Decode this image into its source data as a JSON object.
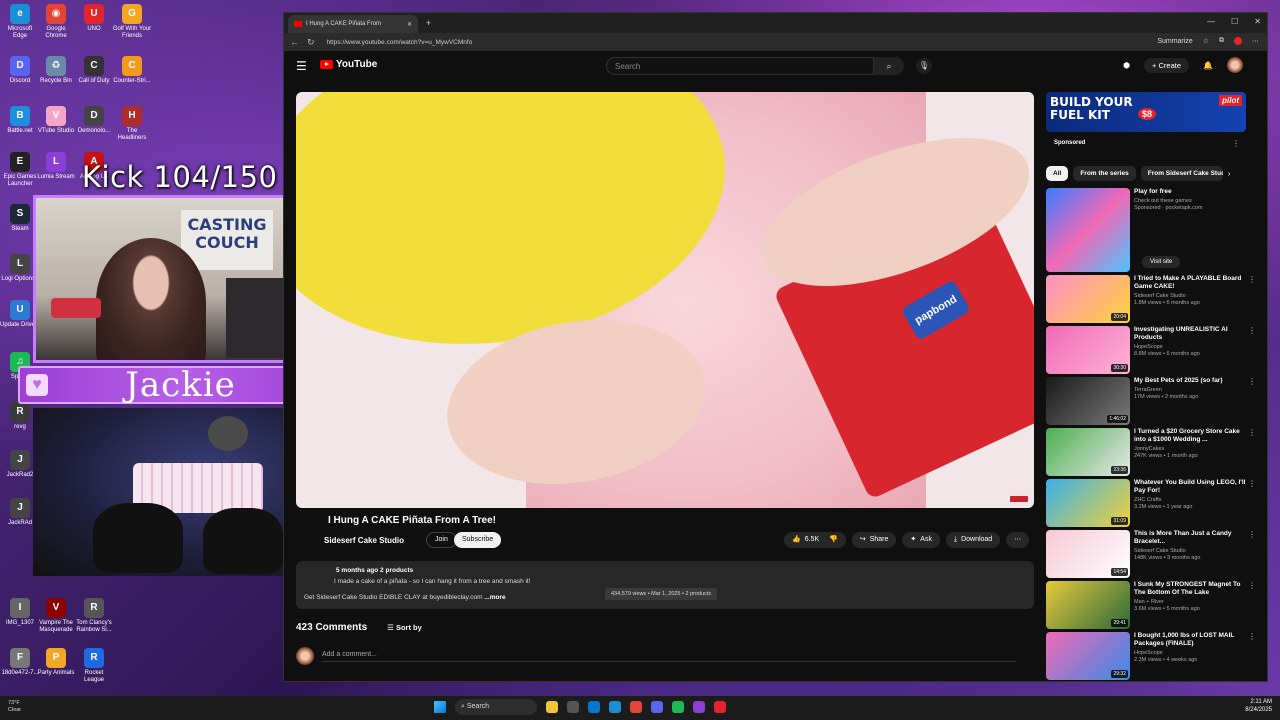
{
  "desktop": {
    "icons": [
      {
        "label": "Microsoft Edge",
        "glyph": "e",
        "color": "#1b8fd6"
      },
      {
        "label": "Google Chrome",
        "glyph": "◉",
        "color": "#e54335"
      },
      {
        "label": "UNO",
        "glyph": "U",
        "color": "#e4232b"
      },
      {
        "label": "Golf With Your Friends",
        "glyph": "G",
        "color": "#f2a623"
      },
      {
        "label": "Discord",
        "glyph": "D",
        "color": "#5865f2"
      },
      {
        "label": "Recycle Bin",
        "glyph": "♻",
        "color": "#6a8aa8"
      },
      {
        "label": "Call of Duty",
        "glyph": "C",
        "color": "#333333"
      },
      {
        "label": "Counter-Stri...",
        "glyph": "C",
        "color": "#f29a1f"
      },
      {
        "label": "Battle.net",
        "glyph": "B",
        "color": "#1d8fe1"
      },
      {
        "label": "VTube Studio",
        "glyph": "V",
        "color": "#f5a5c8"
      },
      {
        "label": "Demonolo...",
        "glyph": "D",
        "color": "#444444"
      },
      {
        "label": "The Headliners",
        "glyph": "H",
        "color": "#b02b2b"
      },
      {
        "label": "Epic Games Launcher",
        "glyph": "E",
        "color": "#222222"
      },
      {
        "label": "Lumia Stream",
        "glyph": "L",
        "color": "#8a3fd6"
      },
      {
        "label": "Among Us",
        "glyph": "A",
        "color": "#c51111"
      },
      {
        "label": "Steam",
        "glyph": "S",
        "color": "#1b2838"
      },
      {
        "label": "Logi Options+",
        "glyph": "L",
        "color": "#444444"
      },
      {
        "label": "Update Drivers",
        "glyph": "U",
        "color": "#2d7ad6"
      },
      {
        "label": "Spotify",
        "glyph": "♫",
        "color": "#1db954"
      },
      {
        "label": "revg",
        "glyph": "R",
        "color": "#3a3a3a"
      },
      {
        "label": "JackRad2",
        "glyph": "J",
        "color": "#444444"
      },
      {
        "label": "JackRAd",
        "glyph": "J",
        "color": "#444444"
      },
      {
        "label": "IMG_1307",
        "glyph": "I",
        "color": "#666666"
      },
      {
        "label": "Vampire The Masquerade",
        "glyph": "V",
        "color": "#8b0000"
      },
      {
        "label": "Tom Clancy's Rainbow Si...",
        "glyph": "R",
        "color": "#555555"
      },
      {
        "label": "18d0e472-7...",
        "glyph": "F",
        "color": "#777777"
      },
      {
        "label": "Party Animals",
        "glyph": "P",
        "color": "#f2a623"
      },
      {
        "label": "Rocket League",
        "glyph": "R",
        "color": "#1d6ae1"
      }
    ]
  },
  "overlay": {
    "kick_counter": "Kick 104/150",
    "webcam_poster": "CASTING COUCH",
    "streamer_name": "Jackie",
    "heart": "♥"
  },
  "browser": {
    "tab_title": "I Hung A CAKE Piñata From",
    "new_tab": "+",
    "window_controls": [
      "—",
      "☐",
      "✕"
    ],
    "url": "https://www.youtube.com/watch?v=u_MywVCMnfo",
    "summarize": "Summarize",
    "nav_back": "←",
    "nav_reload": "↻"
  },
  "youtube": {
    "logo_text": "YouTube",
    "search_placeholder": "Search",
    "create_label": "+ Create",
    "video": {
      "title": "I Hung A CAKE Piñata From A Tree!",
      "channel": "Sideserf Cake Studio",
      "join": "Join",
      "subscribe": "Subscribe",
      "likes": "6.5K",
      "share": "Share",
      "ask": "Ask",
      "download": "Download",
      "desc_meta": "5 months ago  2 products",
      "desc_line1": "I made a cake of a piñata - so I can hang it from a tree and smash it!",
      "desc_line2": "Get Sideserf Cake Studio EDIBLE CLAY at buyedibleclay.com",
      "more": "...more",
      "tooltip": "434,579 views • Mar 1, 2025 • 2 products",
      "candy_label": "papbond"
    },
    "comments": {
      "count": "423 Comments",
      "sort": "Sort by",
      "placeholder": "Add a comment..."
    },
    "ad": {
      "banner_text": "BUILD YOUR FUEL KIT",
      "price": "$8",
      "brand": "pilot",
      "sponsored": "Sponsored"
    },
    "chips": [
      "All",
      "From the series",
      "From Sideserf Cake Studio"
    ],
    "ad_game": {
      "title": "Play for free",
      "subtitle": "Check out these games",
      "sponsor": "Sponsored · pocketapk.com",
      "visit": "Visit site"
    },
    "recommendations": [
      {
        "title": "I Tried to Make A PLAYABLE Board Game CAKE!",
        "channel": "Sideserf Cake Studio",
        "stats": "1.8M views • 6 months ago",
        "duration": "20:04",
        "c1": "#ff8fc7",
        "c2": "#ffd23a"
      },
      {
        "title": "Investigating UNREALISTIC AI Products",
        "channel": "HopeScope",
        "stats": "8.8M views • 6 months ago",
        "duration": "30:30",
        "c1": "#f06ab5",
        "c2": "#ffb3d9"
      },
      {
        "title": "My Best Pets of 2025 (so far)",
        "channel": "TerraGreen",
        "stats": "17M views • 2 months ago",
        "duration": "1:46:02",
        "c1": "#1a1a1a",
        "c2": "#7a7a7a"
      },
      {
        "title": "I Turned a $20 Grocery Store Cake into a $1000 Wedding ...",
        "channel": "JonnyCakes",
        "stats": "247K views • 1 month ago",
        "duration": "23:36",
        "c1": "#4caf50",
        "c2": "#e8e8e8"
      },
      {
        "title": "Whatever You Build Using LEGO, I'll Pay For!",
        "channel": "ZHC Crafts",
        "stats": "3.2M views • 1 year ago",
        "duration": "31:09",
        "c1": "#3ab0e8",
        "c2": "#f2d23a"
      },
      {
        "title": "This is More Than Just a Candy Bracelet...",
        "channel": "Sideserf Cake Studio",
        "stats": "148K views • 3 months ago",
        "duration": "14:54",
        "c1": "#f7c8d6",
        "c2": "#ffffff"
      },
      {
        "title": "I Sunk My STRONGEST Magnet To The Bottom Of The Lake",
        "channel": "Man + River",
        "stats": "3.6M views • 5 months ago",
        "duration": "29:41",
        "c1": "#e8c93a",
        "c2": "#2a6a3a"
      },
      {
        "title": "I Bought 1,000 lbs of LOST MAIL Packages (FINALE)",
        "channel": "HopeScope",
        "stats": "2.3M views • 4 weeks ago",
        "duration": "29:32",
        "c1": "#f06ab5",
        "c2": "#3a8ae8"
      }
    ]
  },
  "taskbar": {
    "weather_temp": "73°F",
    "weather_desc": "Clear",
    "search": "Search",
    "time": "2:11 AM",
    "date": "8/24/2025"
  },
  "colors": {
    "yt_red": "#ff0000",
    "accent_purple": "#c77dff"
  }
}
